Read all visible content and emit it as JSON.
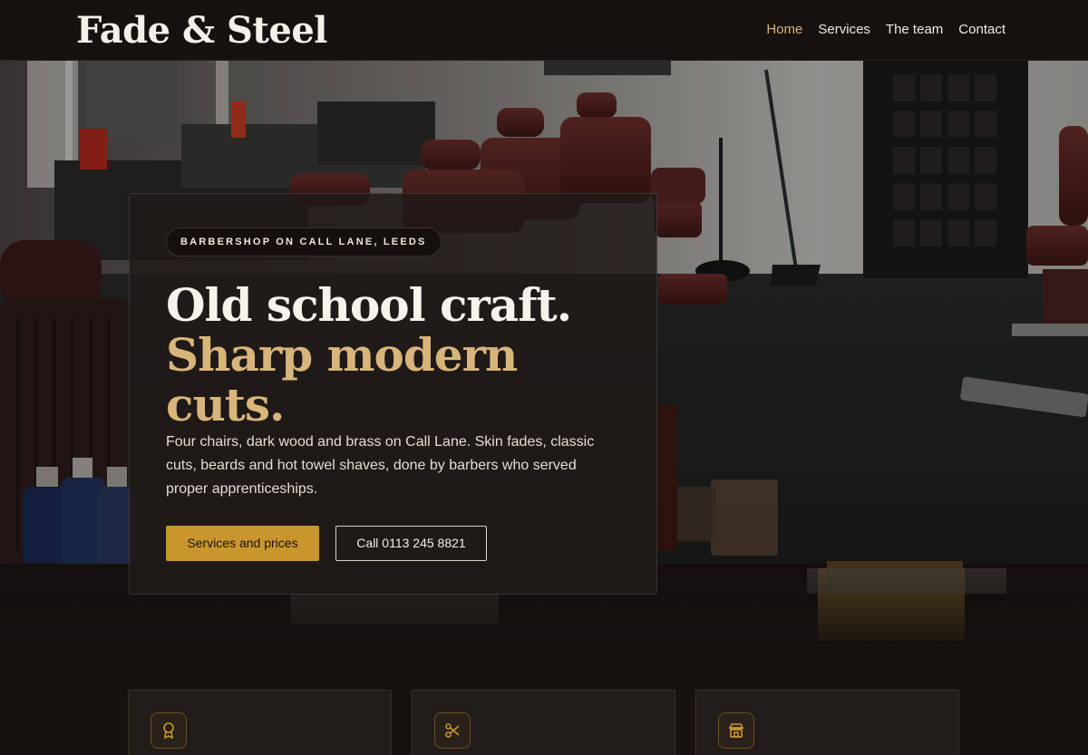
{
  "brand": {
    "name": "Fade & Steel"
  },
  "nav": {
    "items": [
      {
        "label": "Home",
        "active": true
      },
      {
        "label": "Services",
        "active": false
      },
      {
        "label": "The team",
        "active": false
      },
      {
        "label": "Contact",
        "active": false
      }
    ]
  },
  "hero": {
    "eyebrow": "BARBERSHOP ON CALL LANE, LEEDS",
    "headline_line_1": "Old school craft.",
    "headline_line_2": "Sharp modern cuts.",
    "lead": "Four chairs, dark wood and brass on Call Lane. Skin fades, classic cuts, beards and hot towel shaves, done by barbers who served proper apprenticeships.",
    "primary_button": "Services and prices",
    "secondary_button": "Call 0113 245 8821"
  },
  "features": [
    {
      "icon": "award-icon"
    },
    {
      "icon": "scissors-icon"
    },
    {
      "icon": "store-icon"
    }
  ],
  "colors": {
    "background": "#171210",
    "accent_gold": "#c9962e",
    "headline_gold": "#d8b57a",
    "text_light": "#f3ece3"
  }
}
